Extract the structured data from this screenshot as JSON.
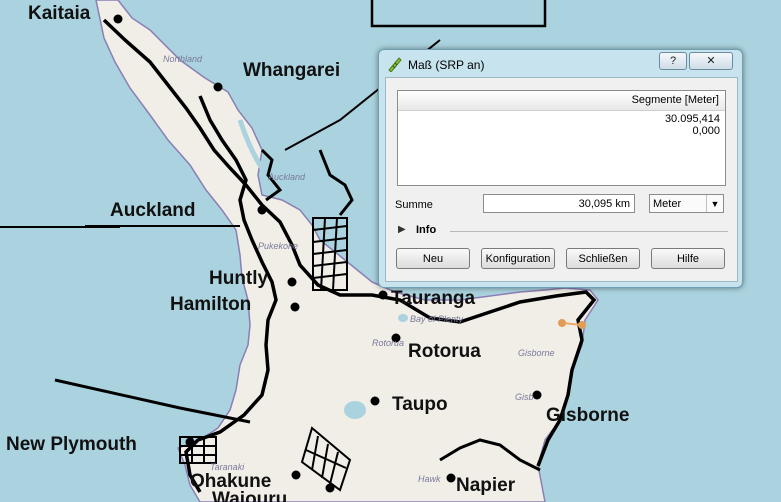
{
  "map": {
    "cities": [
      "Kaitaia",
      "Whangarei",
      "Auckland",
      "Huntly",
      "Hamilton",
      "Tauranga",
      "Rotorua",
      "Taupo",
      "Gisborne",
      "New Plymouth",
      "Ohakune",
      "Napier",
      "Waiouru"
    ],
    "regions": [
      "Northland",
      "Auckland",
      "Bay of Plenty",
      "Gisborne",
      "Taranaki",
      "Hawk"
    ],
    "small_labels": [
      "Pukekohe",
      "Rotorua",
      "Gisb"
    ]
  },
  "dialog": {
    "title": "Maß (SRP an)",
    "help_btn": "?",
    "close_btn": "✕",
    "table_header": "Segmente [Meter]",
    "segments": [
      "30.095,414",
      "0,000"
    ],
    "sum_label": "Summe",
    "sum_value": "30,095 km",
    "unit": "Meter",
    "info_label": "Info",
    "buttons": {
      "new": "Neu",
      "config": "Konfiguration",
      "close": "Schließen",
      "help": "Hilfe"
    }
  }
}
